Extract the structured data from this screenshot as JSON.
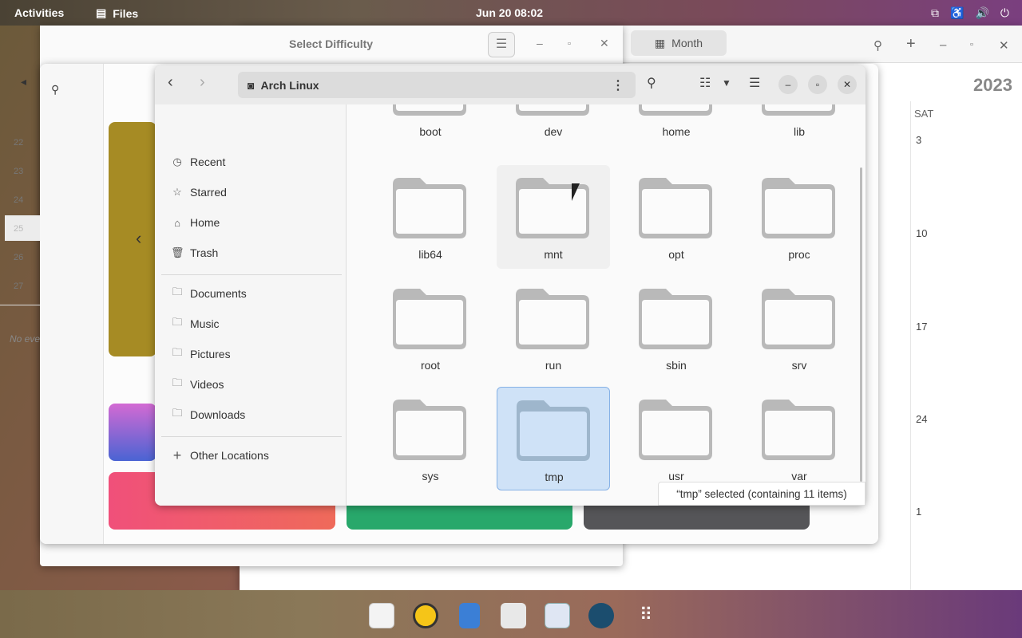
{
  "topbar": {
    "activities": "Activities",
    "app_name": "Files",
    "clock": "Jun 20  08:02"
  },
  "calendar": {
    "view_button": "Month",
    "year": "2023",
    "day_header": "SAT",
    "saturdays": [
      "3",
      "10",
      "17",
      "24",
      "1"
    ]
  },
  "difficulty": {
    "title": "Select Difficulty"
  },
  "bg_calendar": {
    "week_numbers": [
      "22",
      "23",
      "24",
      "25",
      "26",
      "27"
    ],
    "no_events": "No eve"
  },
  "files": {
    "path": "Arch Linux",
    "sidebar": {
      "places": [
        "Recent",
        "Starred",
        "Home",
        "Trash"
      ],
      "bookmarks": [
        "Documents",
        "Music",
        "Pictures",
        "Videos",
        "Downloads"
      ],
      "other": "Other Locations"
    },
    "folders": [
      "boot",
      "dev",
      "home",
      "lib",
      "lib64",
      "mnt",
      "opt",
      "proc",
      "root",
      "run",
      "sbin",
      "srv",
      "sys",
      "tmp",
      "usr",
      "var"
    ],
    "selected": "tmp",
    "status": "“tmp” selected  (containing 11 items)"
  },
  "colors": {
    "folder": "#b9b9b9",
    "selection": "#cfe2f7",
    "accent": "#86b1e6",
    "tile_olive": "#a68b24",
    "tile_pink": "#f0507a",
    "tile_green": "#28a86b"
  },
  "dock": {
    "apps": [
      "calendar-icon",
      "rhythmbox-icon",
      "files-icon",
      "software-icon",
      "tile-puzzle-icon",
      "screenshot-icon",
      "app-grid-icon"
    ]
  }
}
